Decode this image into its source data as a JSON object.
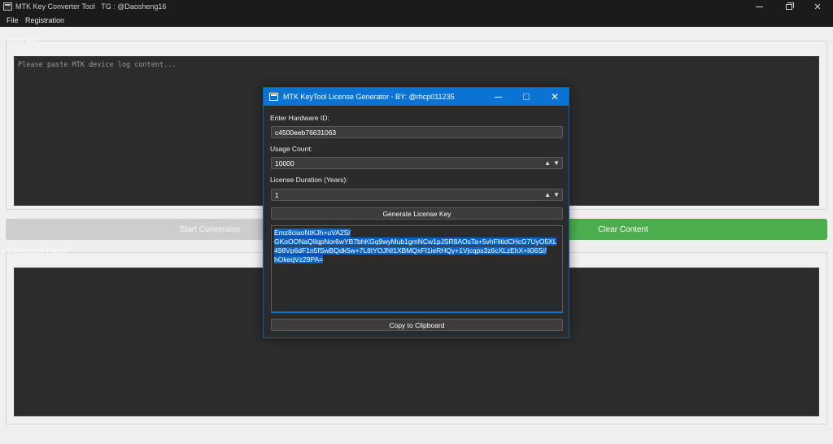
{
  "main_window": {
    "title": "MTK Key Converter Tool   TG : @Daosheng16",
    "menu": [
      "File",
      "Registration"
    ],
    "input_group_label": "Input Log",
    "log_placeholder": "Please paste MTK device log content...",
    "start_button": "Start Conversion",
    "clear_button": "Clear Content",
    "output_group_label": "Conversion Result"
  },
  "dialog": {
    "title": "MTK KeyTool License Generator - BY: @rhcp011235",
    "hardware_id_label": "Enter Hardware ID:",
    "hardware_id_value": "c4500eeb76631063",
    "usage_count_label": "Usage Count:",
    "usage_count_value": "10000",
    "duration_label": "License Duration (Years):",
    "duration_value": "1",
    "generate_button": "Generate License Key",
    "license_key_lines": [
      "Emz8ciaoNtKJh+uVA2S/",
      "GKoOONaQIlqpNor6wYB7bhKGq9wyMub1gmNCw1pJSR8AOsTa+5vhFlitidCHcG7UyO5XL",
      "498Vp6dF1n5fSwBQdk5w+7L8tYOJNI1XBMQxFI1ieRHQy+1Vjcqps3z6cXLzEhX+li06S//",
      "hOkeqVz29PA="
    ],
    "copy_button": "Copy to Clipboard"
  },
  "colors": {
    "accent_blue": "#0a73d4",
    "clear_green": "#4cad4e",
    "selection_blue": "#0a64c8"
  },
  "icons": [
    "app-window-icon",
    "minimize-icon",
    "maximize-icon",
    "close-icon",
    "spin-up-icon",
    "spin-down-icon"
  ]
}
